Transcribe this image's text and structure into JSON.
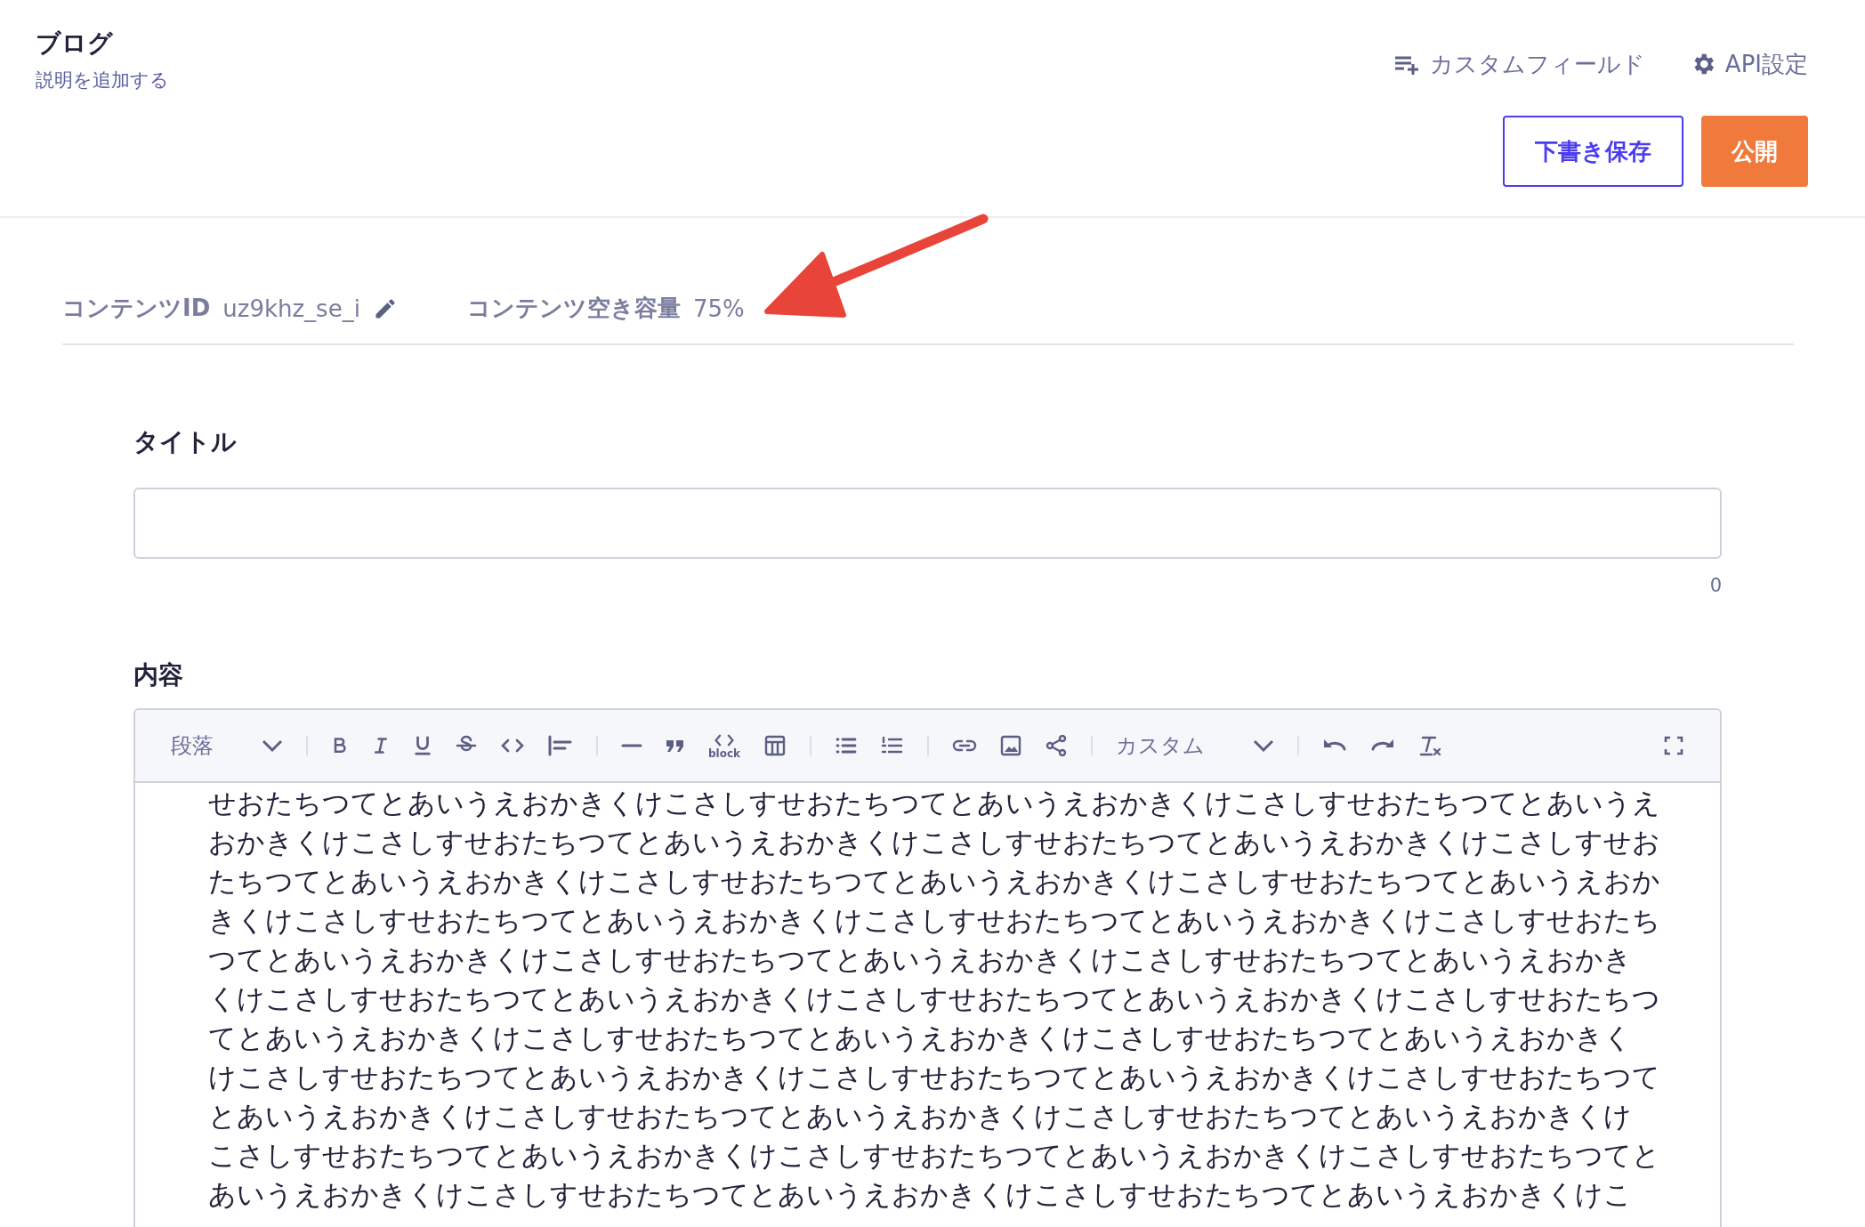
{
  "header": {
    "title": "ブログ",
    "description": "説明を追加する",
    "links": [
      "カスタムフィールド",
      "API設定"
    ],
    "buttons": [
      "下書き保存",
      "公開"
    ]
  },
  "info": {
    "id_label": "コンテンツID",
    "id_value": "uz9khz_se_i",
    "capacity_label": "コンテンツ空き容量",
    "capacity_value": "75%"
  },
  "title_field": {
    "label": "タイトル",
    "counter": "0"
  },
  "content_field": {
    "label": "内容",
    "toolbar": {
      "format_select": "段落",
      "code_block_caption": "block",
      "custom_select": "カスタム"
    },
    "lines": [
      "せおたちつてとあいうえおかきくけこさしすせおたちつてとあいうえおかきくけこさしすせおたちつてとあいうえ",
      "おかきくけこさしすせおたちつてとあいうえおかきくけこさしすせおたちつてとあいうえおかきくけこさしすせお",
      "たちつてとあいうえおかきくけこさしすせおたちつてとあいうえおかきくけこさしすせおたちつてとあいうえおか",
      "きくけこさしすせおたちつてとあいうえおかきくけこさしすせおたちつてとあいうえおかきくけこさしすせおたち",
      "つてとあいうえおかきくけこさしすせおたちつてとあいうえおかきくけこさしすせおたちつてとあいうえおかき",
      "くけこさしすせおたちつてとあいうえおかきくけこさしすせおたちつてとあいうえおかきくけこさしすせおたちつ",
      "てとあいうえおかきくけこさしすせおたちつてとあいうえおかきくけこさしすせおたちつてとあいうえおかきく",
      "けこさしすせおたちつてとあいうえおかきくけこさしすせおたちつてとあいうえおかきくけこさしすせおたちつて",
      "とあいうえおかきくけこさしすせおたちつてとあいうえおかきくけこさしすせおたちつてとあいうえおかきくけ",
      "こさしすせおたちつてとあいうえおかきくけこさしすせおたちつてとあいうえおかきくけこさしすせおたちつてと",
      "あいうえおかきくけこさしすせおたちつてとあいうえおかきくけこさしすせおたちつてとあいうえおかきくけこ"
    ]
  }
}
